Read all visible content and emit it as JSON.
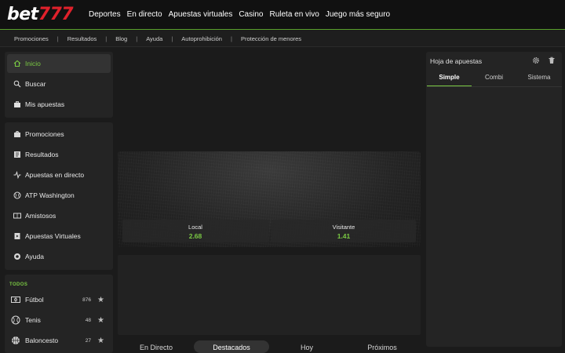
{
  "brand": {
    "logo_text": "bet",
    "logo_num": "777",
    "accent": "#7ac943",
    "brand_red": "#e0212b"
  },
  "main_nav": [
    "Deportes",
    "En directo",
    "Apuestas virtuales",
    "Casino",
    "Ruleta en vivo",
    "Juego más seguro"
  ],
  "sub_nav": [
    "Promociones",
    "Resultados",
    "Blog",
    "Ayuda",
    "Autoprohibición",
    "Protección de menores"
  ],
  "sidebar": {
    "top": [
      {
        "label": "Inicio",
        "icon": "home-icon",
        "active": true
      },
      {
        "label": "Buscar",
        "icon": "search-icon"
      },
      {
        "label": "Mis apuestas",
        "icon": "briefcase-icon"
      }
    ],
    "menu": [
      {
        "label": "Promociones",
        "icon": "promo-icon"
      },
      {
        "label": "Resultados",
        "icon": "results-icon"
      },
      {
        "label": "Apuestas en directo",
        "icon": "live-icon"
      },
      {
        "label": "ATP Washington",
        "icon": "tennis-ball-icon"
      },
      {
        "label": "Amistosos",
        "icon": "friendly-icon"
      },
      {
        "label": "Apuestas Virtuales",
        "icon": "virtual-icon"
      },
      {
        "label": "Ayuda",
        "icon": "help-icon"
      }
    ],
    "sports_header": "TODOS",
    "sports": [
      {
        "label": "Fútbol",
        "count": "876",
        "icon": "football-icon"
      },
      {
        "label": "Tenis",
        "count": "48",
        "icon": "tennis-icon"
      },
      {
        "label": "Baloncesto",
        "count": "27",
        "icon": "basketball-icon"
      }
    ]
  },
  "banner": {
    "local_label": "Local",
    "local_odds": "2.68",
    "visit_label": "Visitante",
    "visit_odds": "1.41"
  },
  "tabs": [
    {
      "label": "En Directo"
    },
    {
      "label": "Destacados",
      "selected": true
    },
    {
      "label": "Hoy"
    },
    {
      "label": "Próximos"
    }
  ],
  "betslip": {
    "title": "Hoja de apuestas",
    "tabs": [
      {
        "label": "Simple",
        "selected": true
      },
      {
        "label": "Combi"
      },
      {
        "label": "Sistema"
      }
    ]
  }
}
